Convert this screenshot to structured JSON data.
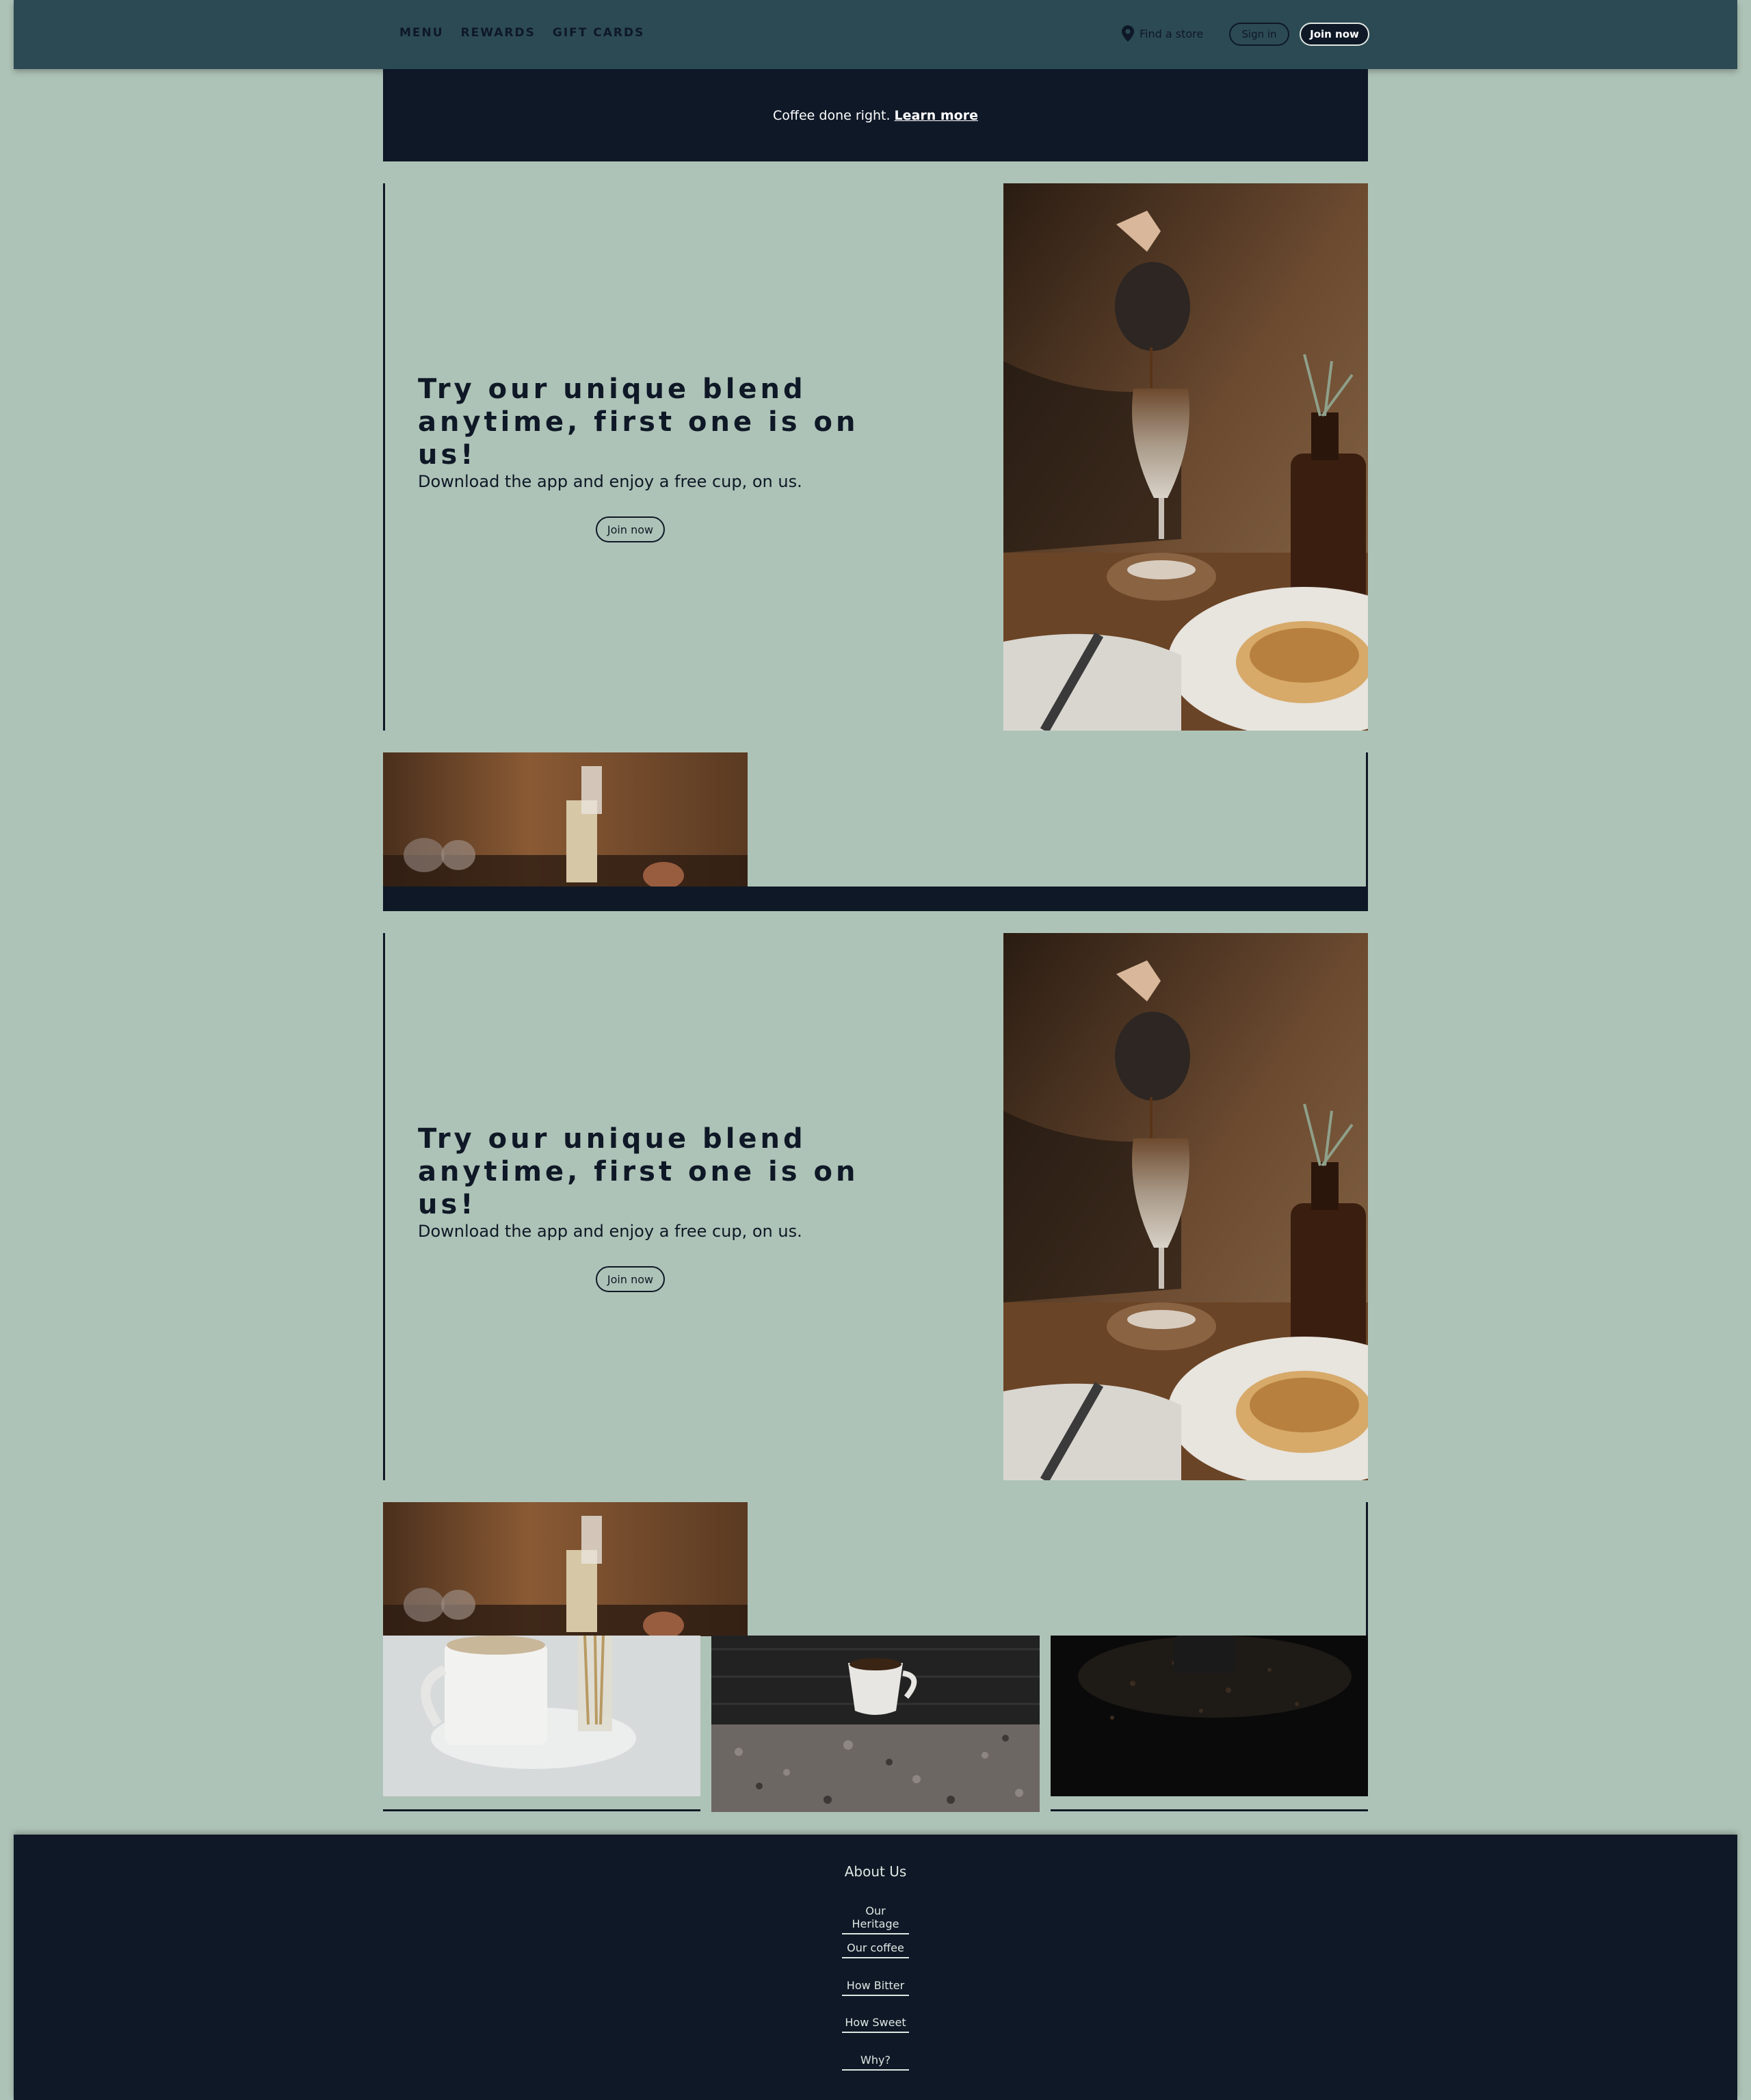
{
  "header": {
    "nav": [
      "MENU",
      "REWARDS",
      "GIFT CARDS"
    ],
    "find_store": "Find a store",
    "sign_in": "Sign in",
    "join_now": "Join now"
  },
  "banner": {
    "text": "Coffee done right.",
    "link": "Learn more"
  },
  "heroes": [
    {
      "title": "Try our unique blend anytime, first one is on us!",
      "subtitle": "Download the app and enjoy a free cup, on us.",
      "button": "Join now"
    },
    {
      "title": "Try our unique blend anytime, first one is on us!",
      "subtitle": "Download the app and enjoy a free cup, on us.",
      "button": "Join now"
    }
  ],
  "footer": {
    "title": "About Us",
    "links": [
      "Our Heritage",
      "Our coffee",
      "How Bitter",
      "How Sweet",
      "Why?"
    ]
  },
  "colors": {
    "page_bg": "#aec3b7",
    "header_bg": "#2c4a53",
    "navy": "#0e1826",
    "light_text": "#dfe7e3"
  }
}
